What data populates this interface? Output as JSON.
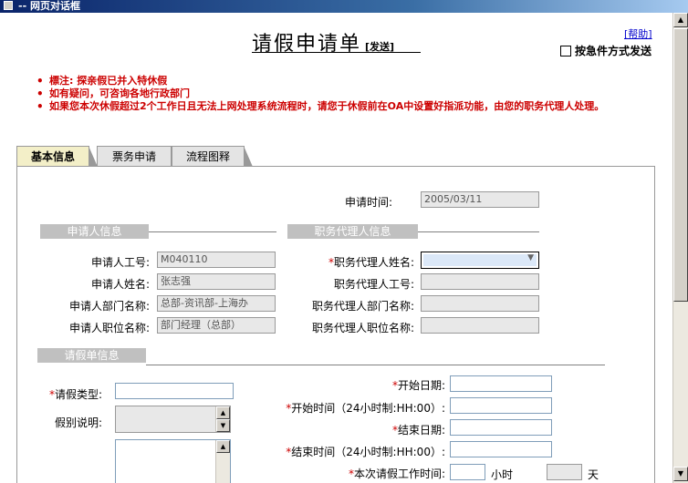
{
  "window": {
    "title": "-- 网页对话框"
  },
  "header": {
    "title": "请假申请单",
    "send_label": "[发送]",
    "help_link": "[帮助]",
    "urgent_label": "按急件方式发送"
  },
  "notes": [
    "標注: 探亲假已并入特休假",
    "如有疑问，可咨询各地行政部门",
    "如果您本次休假超过2个工作日且无法上网处理系统流程时，请您于休假前在OA中设置好指派功能，由您的职务代理人处理。"
  ],
  "tabs": [
    {
      "label": "基本信息",
      "active": true
    },
    {
      "label": "票务申请",
      "active": false
    },
    {
      "label": "流程图释",
      "active": false
    }
  ],
  "form": {
    "apply_time_label": "申请时间:",
    "apply_time_value": "2005/03/11",
    "applicant_section": "申请人信息",
    "agent_section": "职务代理人信息",
    "leave_section": "请假单信息",
    "emp_no_label": "申请人工号:",
    "emp_no_value": "M040110",
    "name_label": "申请人姓名:",
    "name_value": "张志强",
    "dept_label": "申请人部门名称:",
    "dept_value": "总部-资讯部-上海办",
    "position_label": "申请人职位名称:",
    "position_value": "部门经理（总部）",
    "agent_name_label": "职务代理人姓名:",
    "agent_no_label": "职务代理人工号:",
    "agent_dept_label": "职务代理人部门名称:",
    "agent_position_label": "职务代理人职位名称:",
    "leave_type_label": "请假类型:",
    "leave_desc_label": "假别说明:",
    "start_date_label": "开始日期:",
    "start_time_label": "开始时间（24小时制:HH:00）:",
    "end_date_label": "结束日期:",
    "end_time_label": "结束时间（24小时制:HH:00）:",
    "work_time_label": "本次请假工作时间:",
    "hours_unit": "小时",
    "days_unit": "天",
    "required_mark": "*"
  },
  "colors": {
    "required": "#cc0000",
    "note_text": "#cc0000",
    "title_bar": "#0a246a"
  }
}
